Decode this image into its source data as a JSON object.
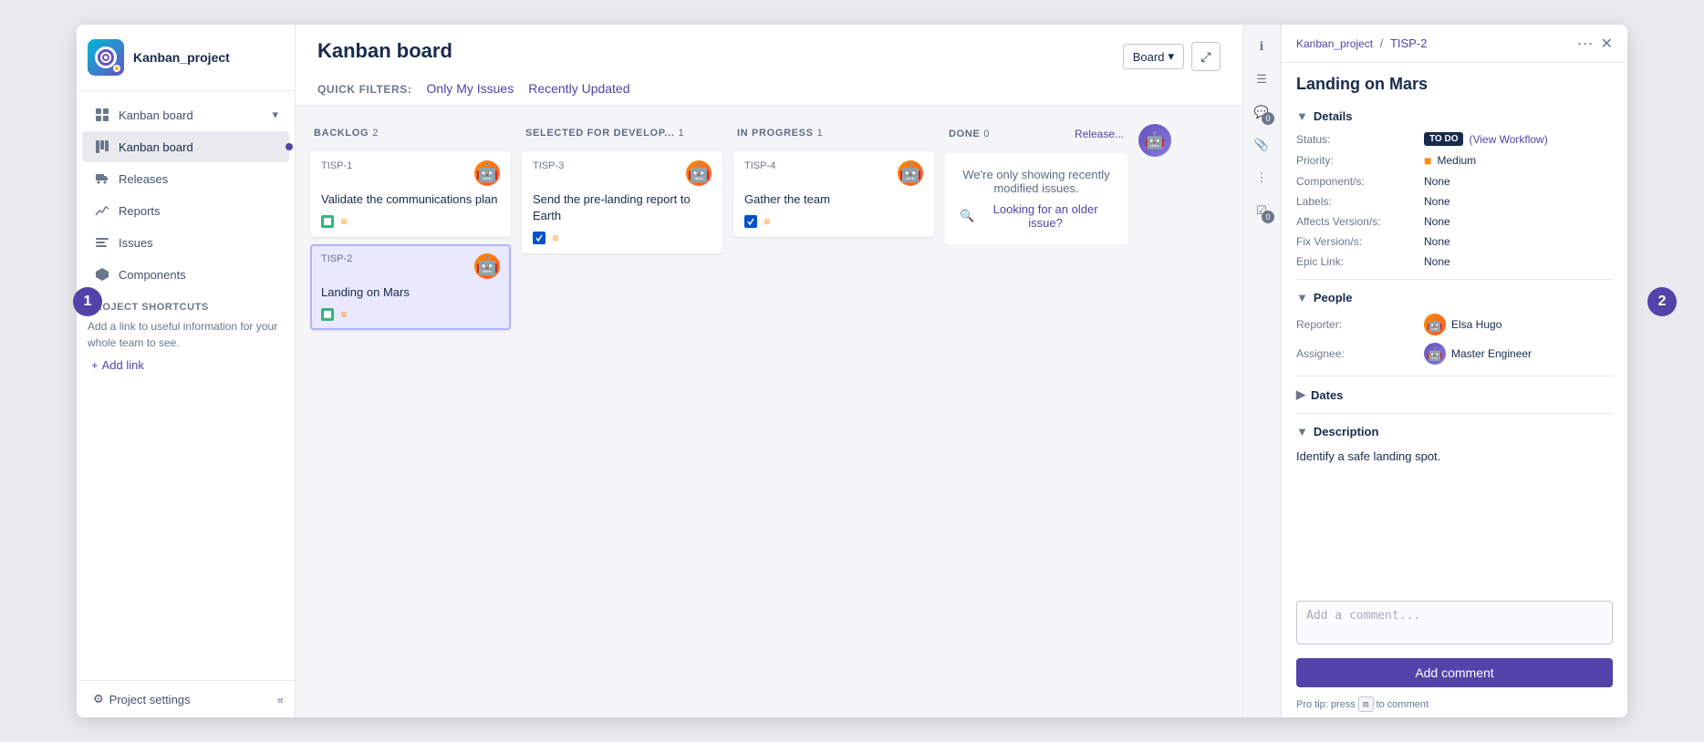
{
  "app": {
    "title": "Kanban_project"
  },
  "sidebar": {
    "project_name": "Kanban_project",
    "nav_items": [
      {
        "id": "kanban-board-parent",
        "label": "Kanban board",
        "icon": "grid",
        "has_chevron": true
      },
      {
        "id": "kanban-board",
        "label": "Kanban board",
        "icon": "board",
        "active": true
      },
      {
        "id": "releases",
        "label": "Releases",
        "icon": "truck"
      },
      {
        "id": "reports",
        "label": "Reports",
        "icon": "chart"
      },
      {
        "id": "issues",
        "label": "Issues",
        "icon": "list"
      },
      {
        "id": "components",
        "label": "Components",
        "icon": "component"
      }
    ],
    "shortcuts_title": "PROJECT SHORTCUTS",
    "shortcuts_desc": "Add a link to useful information for your whole team to see.",
    "add_link_label": "Add link",
    "settings_label": "Project settings"
  },
  "board": {
    "title": "Kanban board",
    "quick_filters_label": "QUICK FILTERS:",
    "filter_my_issues": "Only My Issues",
    "filter_recently_updated": "Recently Updated",
    "board_btn": "Board",
    "columns": [
      {
        "id": "backlog",
        "title": "BACKLOG",
        "count": 2,
        "cards": [
          {
            "id": "TISP-1",
            "title": "Validate the communications plan",
            "avatar": "orange",
            "has_green_badge": true,
            "has_priority": true
          },
          {
            "id": "TISP-2",
            "title": "Landing on Mars",
            "avatar": "orange",
            "has_green_badge": true,
            "has_priority": true,
            "selected": true
          }
        ]
      },
      {
        "id": "selected",
        "title": "SELECTED FOR DEVELOP...",
        "count": 1,
        "cards": [
          {
            "id": "TISP-3",
            "title": "Send the pre-landing report to Earth",
            "avatar": "orange",
            "has_blue_badge": true,
            "has_priority": true
          }
        ]
      },
      {
        "id": "in-progress",
        "title": "IN PROGRESS",
        "count": 1,
        "cards": [
          {
            "id": "TISP-4",
            "title": "Gather the team",
            "avatar": "orange",
            "has_blue_badge": true,
            "has_priority": true
          }
        ]
      },
      {
        "id": "done",
        "title": "DONE",
        "count": 0,
        "extra_label": "Release...",
        "done_message": "We're only showing recently modified issues.",
        "older_issue_link": "Looking for an older issue?"
      }
    ]
  },
  "issue_panel": {
    "breadcrumb_project": "Kanban_project",
    "breadcrumb_sep": "/",
    "breadcrumb_issue": "TISP-2",
    "title": "Landing on Mars",
    "details_label": "Details",
    "status_label": "Status:",
    "status_value": "TO DO",
    "workflow_link": "(View Workflow)",
    "priority_label": "Priority:",
    "priority_value": "Medium",
    "components_label": "Component/s:",
    "components_value": "None",
    "labels_label": "Labels:",
    "labels_value": "None",
    "affects_label": "Affects Version/s:",
    "affects_value": "None",
    "fix_label": "Fix Version/s:",
    "fix_value": "None",
    "epic_label": "Epic Link:",
    "epic_value": "None",
    "people_label": "People",
    "reporter_label": "Reporter:",
    "reporter_name": "Elsa Hugo",
    "assignee_label": "Assignee:",
    "assignee_name": "Master Engineer",
    "dates_label": "Dates",
    "desc_label": "Description",
    "desc_text": "Identify a safe landing spot.",
    "comment_placeholder": "Add a comment...",
    "add_comment_label": "Add comment",
    "pro_tip": "Pro tip: press",
    "pro_tip_key": "m",
    "pro_tip_suffix": "to comment",
    "side_icons": [
      {
        "id": "info",
        "icon": "ℹ"
      },
      {
        "id": "activity",
        "icon": "☰"
      },
      {
        "id": "comment",
        "icon": "💬",
        "badge": "0"
      },
      {
        "id": "attachment",
        "icon": "📎"
      },
      {
        "id": "more",
        "icon": "⋮"
      },
      {
        "id": "checklist",
        "icon": "☑",
        "badge": "0"
      }
    ]
  },
  "tutorial": {
    "badge1": "1",
    "badge2": "2"
  }
}
